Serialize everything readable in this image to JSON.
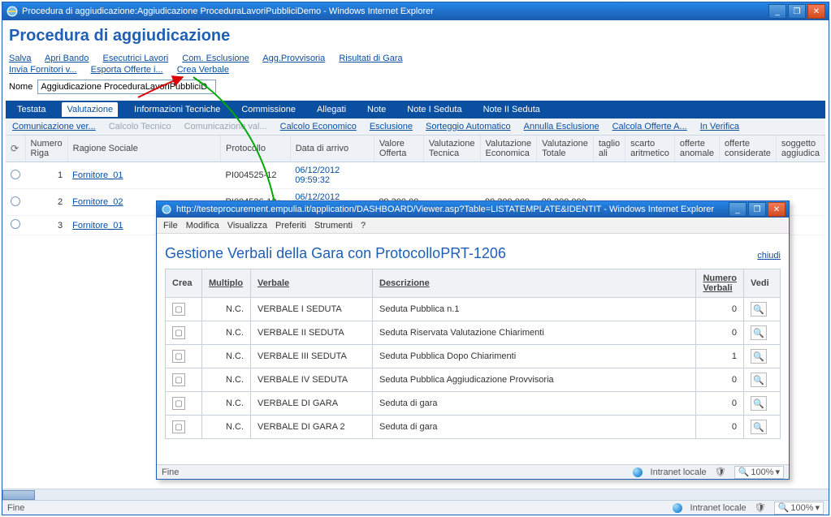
{
  "main_window": {
    "title": "Procedura di aggiudicazione:Aggiudicazione ProceduraLavoriPubbliciDemo - Windows Internet Explorer",
    "page_heading": "Procedura di aggiudicazione",
    "links_row1": [
      "Salva",
      "Apri Bando",
      "Esecutrici Lavori",
      "Com. Esclusione",
      "Agg.Provvisoria",
      "Risultati di Gara"
    ],
    "links_row2": [
      "Invia Fornitori v...",
      "Esporta Offerte i...",
      "Crea Verbale"
    ],
    "name_label": "Nome",
    "name_value": "Aggiudicazione ProceduraLavoriPubbliciD",
    "tabs": [
      "Testata",
      "Valutazione",
      "Informazioni Tecniche",
      "Commissione",
      "Allegati",
      "Note",
      "Note I Seduta",
      "Note II Seduta"
    ],
    "active_tab": "Valutazione",
    "sub_links": [
      {
        "label": "Comunicazione ver...",
        "enabled": true
      },
      {
        "label": "Calcolo Tecnico",
        "enabled": false
      },
      {
        "label": "Comunicazione val...",
        "enabled": false
      },
      {
        "label": "Calcolo Economico",
        "enabled": true
      },
      {
        "label": "Esclusione",
        "enabled": true
      },
      {
        "label": "Sorteggio Automatico",
        "enabled": true
      },
      {
        "label": "Annulla Esclusione",
        "enabled": true
      },
      {
        "label": "Calcola Offerte A...",
        "enabled": true
      },
      {
        "label": "In Verifica",
        "enabled": true
      }
    ],
    "table": {
      "headers": [
        "",
        "Numero Riga",
        "Ragione Sociale",
        "Protocollo",
        "Data di arrivo",
        "Valore Offerta",
        "Valutazione Tecnica",
        "Valutazione Economica",
        "Valutazione Totale",
        "taglio ali",
        "scarto aritmetico",
        "offerte anomale",
        "offerte considerate",
        "soggetto aggiudica"
      ],
      "rows": [
        {
          "num": "1",
          "ragione": "Fornitore_01",
          "proto": "PI004525-12",
          "data": "06/12/2012 09:59:32",
          "val": "",
          "vt": "",
          "ve": "",
          "vtot": "",
          "t": "",
          "s": "",
          "oa": "",
          "oc": "",
          "sa": ""
        },
        {
          "num": "2",
          "ragione": "Fornitore_02",
          "proto": "PI004526-12",
          "data": "06/12/2012 10:08:58",
          "val": "89.300,00",
          "vt": "",
          "ve": "89.300,000",
          "vtot": "89.300,000",
          "t": "",
          "s": "",
          "oa": "",
          "oc": "",
          "sa": ""
        },
        {
          "num": "3",
          "ragione": "Fornitore_01",
          "proto": "",
          "data": "",
          "val": "",
          "vt": "",
          "ve": "",
          "vtot": "",
          "t": "",
          "s": "",
          "oa": "",
          "oc": "",
          "sa": ""
        }
      ]
    },
    "status_left": "Fine",
    "status_zone": "Intranet locale",
    "status_zoom": "100%"
  },
  "popup": {
    "title": "http://testeprocurement.empulia.it/application/DASHBOARD/Viewer.asp?Table=LISTATEMPLATE&IDENTIT - Windows Internet Explorer",
    "menu": [
      "File",
      "Modifica",
      "Visualizza",
      "Preferiti",
      "Strumenti",
      "?"
    ],
    "heading": "Gestione Verbali della Gara con ProtocolloPRT-1206",
    "close_link": "chiudi",
    "headers": {
      "crea": "Crea",
      "mult": "Multiplo",
      "verb": "Verbale",
      "desc": "Descrizione",
      "num": "Numero Verbali",
      "vedi": "Vedi"
    },
    "rows": [
      {
        "mult": "N.C.",
        "verb": "VERBALE I SEDUTA",
        "desc": "Seduta Pubblica n.1",
        "num": "0"
      },
      {
        "mult": "N.C.",
        "verb": "VERBALE II SEDUTA",
        "desc": "Seduta Riservata Valutazione Chiarimenti",
        "num": "0"
      },
      {
        "mult": "N.C.",
        "verb": "VERBALE III SEDUTA",
        "desc": "Seduta Pubblica Dopo Chiarimenti",
        "num": "1"
      },
      {
        "mult": "N.C.",
        "verb": "VERBALE IV SEDUTA",
        "desc": "Seduta Pubblica Aggiudicazione Provvisoria",
        "num": "0"
      },
      {
        "mult": "N.C.",
        "verb": "VERBALE DI GARA",
        "desc": "Seduta di gara",
        "num": "0"
      },
      {
        "mult": "N.C.",
        "verb": "VERBALE DI GARA 2",
        "desc": "Seduta di gara",
        "num": "0"
      }
    ],
    "status_left": "Fine",
    "status_zone": "Intranet locale",
    "status_zoom": "100%"
  }
}
